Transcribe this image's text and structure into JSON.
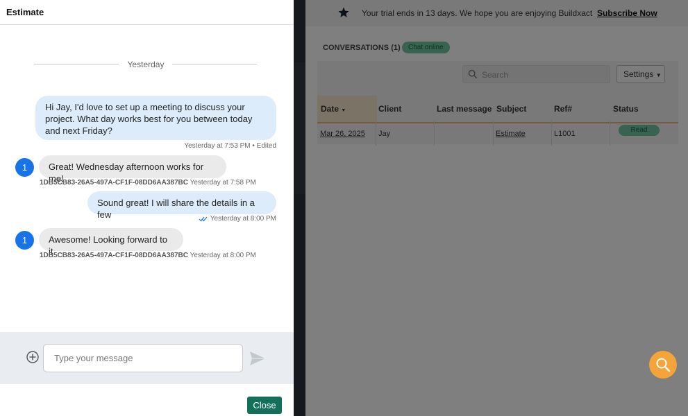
{
  "background_app": {
    "trial_banner": {
      "text": "Your trial ends in 13 days. We hope you are enjoying Buildxact",
      "subscribe_label": "Subscribe Now"
    },
    "conversations_title": "CONVERSATIONS (1)",
    "chat_status": "Chat online",
    "search_placeholder": "Search",
    "settings_label": "Settings",
    "table": {
      "columns": [
        "Date",
        "Client",
        "Last message",
        "Subject",
        "Ref#",
        "Status"
      ],
      "rows": [
        {
          "date": "Mar 26, 2025",
          "client": "Jay",
          "last_message": "",
          "subject": "Estimate",
          "ref": "L1001",
          "status": "Read"
        }
      ]
    }
  },
  "drawer": {
    "title": "Estimate",
    "date_separator": "Yesterday",
    "messages": [
      {
        "direction": "out",
        "text": "Hi Jay, I'd love to set up a meeting to discuss your project. What day works best for you between today and next Friday?",
        "meta": "Yesterday at 7:53 PM • Edited"
      },
      {
        "direction": "in",
        "avatar": "1",
        "text": "Great! Wednesday afternoon works for me!",
        "sender": "1DB5CB83-26A5-497A-CF1F-08DD6AA387BC",
        "time": "Yesterday at 7:58 PM"
      },
      {
        "direction": "out",
        "text": "Sound great! I will share the details in a few",
        "meta": "Yesterday at 8:00 PM"
      },
      {
        "direction": "in",
        "avatar": "1",
        "text": "Awesome! Looking forward to it",
        "sender": "1DB5CB83-26A5-497A-CF1F-08DD6AA387BC",
        "time": "Yesterday at 8:00 PM"
      }
    ],
    "composer": {
      "placeholder": "Type your message"
    },
    "close_label": "Close"
  },
  "colors": {
    "accent_green": "#137059",
    "avatar_blue": "#1774e8",
    "fab_orange": "#f5a43a",
    "out_bubble": "#dcecfb"
  },
  "icons": [
    "star-icon",
    "search-icon",
    "caret-down-icon",
    "sort-desc-icon",
    "double-check-icon",
    "add-circle-icon",
    "send-icon",
    "help-search-icon"
  ]
}
